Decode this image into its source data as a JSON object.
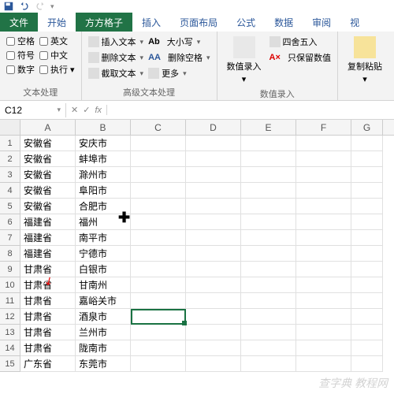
{
  "tabs": {
    "file": "文件",
    "home": "开始",
    "fangfang": "方方格子",
    "insert": "插入",
    "pagelayout": "页面布局",
    "formulas": "公式",
    "data": "数据",
    "review": "审阅",
    "view": "视"
  },
  "group1": {
    "c1": "空格",
    "c2": "符号",
    "c3": "数字",
    "c4": "英文",
    "c5": "中文",
    "c6": "执行",
    "label": "文本处理"
  },
  "group2": {
    "b1": "插入文本",
    "b2": "删除文本",
    "b3": "截取文本",
    "b4": "大小写",
    "b5": "删除空格",
    "b6": "更多",
    "label": "高级文本处理"
  },
  "group3": {
    "big": "数值录入",
    "b1": "四舍五入",
    "b2": "只保留数值",
    "label": "数值录入"
  },
  "group4": {
    "big": "复制粘贴",
    "label": ""
  },
  "namebox": "C12",
  "fx": "fx",
  "cols": [
    "A",
    "B",
    "C",
    "D",
    "E",
    "F",
    "G"
  ],
  "rows": [
    {
      "n": "1",
      "a": "安徽省",
      "b": "安庆市"
    },
    {
      "n": "2",
      "a": "安徽省",
      "b": "蚌埠市"
    },
    {
      "n": "3",
      "a": "安徽省",
      "b": "滁州市"
    },
    {
      "n": "4",
      "a": "安徽省",
      "b": "阜阳市"
    },
    {
      "n": "5",
      "a": "安徽省",
      "b": "合肥市"
    },
    {
      "n": "6",
      "a": "福建省",
      "b": "福州"
    },
    {
      "n": "7",
      "a": "福建省",
      "b": "南平市"
    },
    {
      "n": "8",
      "a": "福建省",
      "b": "宁德市"
    },
    {
      "n": "9",
      "a": "甘肃省",
      "b": "白银市"
    },
    {
      "n": "10",
      "a": "甘肃省",
      "b": "甘南州"
    },
    {
      "n": "11",
      "a": "甘肃省",
      "b": "嘉峪关市"
    },
    {
      "n": "12",
      "a": "甘肃省",
      "b": "酒泉市"
    },
    {
      "n": "13",
      "a": "甘肃省",
      "b": "兰州市"
    },
    {
      "n": "14",
      "a": "甘肃省",
      "b": "陇南市"
    },
    {
      "n": "15",
      "a": "广东省",
      "b": "东莞市"
    }
  ],
  "watermark": "查字典 教程网"
}
